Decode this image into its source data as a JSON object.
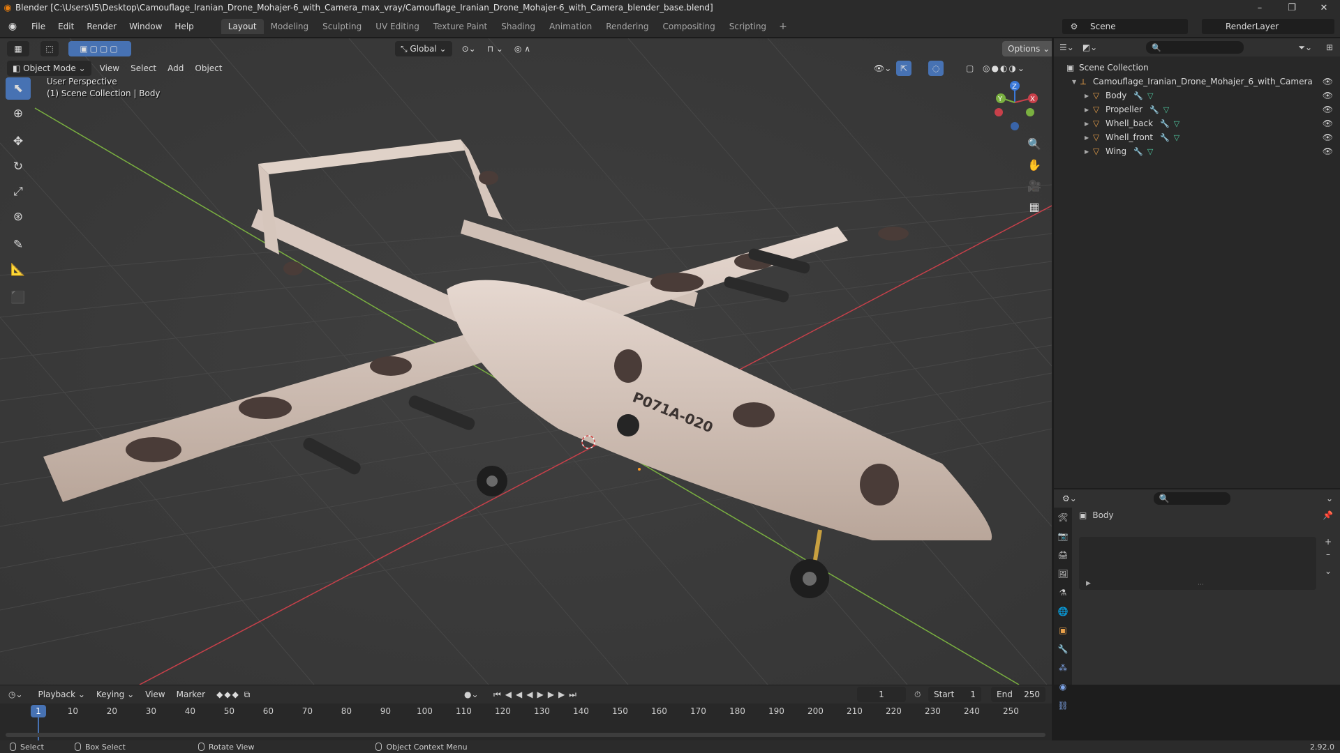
{
  "window": {
    "title": "Blender [C:\\Users\\I5\\Desktop\\Camouflage_Iranian_Drone_Mohajer-6_with_Camera_max_vray/Camouflage_Iranian_Drone_Mohajer-6_with_Camera_blender_base.blend]",
    "minimize": "–",
    "maximize": "❐",
    "close": "✕"
  },
  "menu": [
    "File",
    "Edit",
    "Render",
    "Window",
    "Help"
  ],
  "workspaces": [
    "Layout",
    "Modeling",
    "Sculpting",
    "UV Editing",
    "Texture Paint",
    "Shading",
    "Animation",
    "Rendering",
    "Compositing",
    "Scripting"
  ],
  "active_workspace": "Layout",
  "scene": {
    "name": "Scene",
    "render_layer": "RenderLayer"
  },
  "viewport": {
    "mode": "Object Mode",
    "menus": [
      "View",
      "Select",
      "Add",
      "Object"
    ],
    "transform_orientation": "Global",
    "options_label": "Options",
    "overlay_line1": "User Perspective",
    "overlay_line2": "(1) Scene Collection | Body",
    "model_text": "P071A-020",
    "gizmo": {
      "x": "X",
      "y": "Y",
      "z": "Z"
    }
  },
  "outliner": {
    "root": "Scene Collection",
    "collection": "Camouflage_Iranian_Drone_Mohajer_6_with_Camera",
    "objects": [
      "Body",
      "Propeller",
      "Whell_back",
      "Whell_front",
      "Wing"
    ]
  },
  "properties": {
    "object_name": "Body"
  },
  "timeline": {
    "menus": [
      "Playback",
      "Keying",
      "View",
      "Marker"
    ],
    "current_frame": "1",
    "start_label": "Start",
    "start": "1",
    "end_label": "End",
    "end": "250",
    "ticks": [
      "10",
      "20",
      "30",
      "40",
      "50",
      "60",
      "70",
      "80",
      "90",
      "100",
      "110",
      "120",
      "130",
      "140",
      "150",
      "160",
      "170",
      "180",
      "190",
      "200",
      "210",
      "220",
      "230",
      "240",
      "250"
    ]
  },
  "statusbar": {
    "select": "Select",
    "box_select": "Box Select",
    "rotate": "Rotate View",
    "context": "Object Context Menu",
    "version": "2.92.0"
  },
  "colors": {
    "accent": "#4772b3",
    "object_orange": "#e8a04a",
    "x_axis": "#c8404a",
    "y_axis": "#7ab040"
  }
}
